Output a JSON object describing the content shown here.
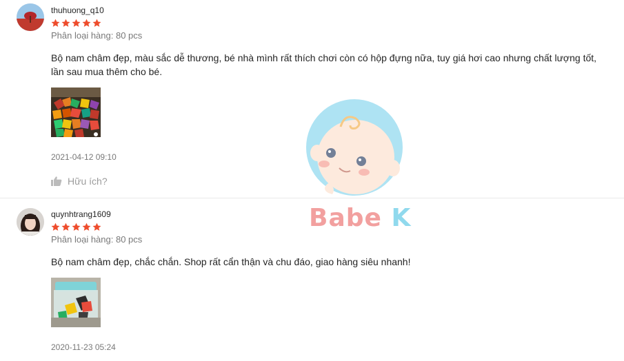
{
  "reviews": [
    {
      "username": "thuhuong_q10",
      "rating": 5,
      "variation": "Phân loại hàng: 80 pcs",
      "comment": "Bộ nam châm đẹp, màu sắc dễ thương, bé nhà mình rất thích chơi còn có hộp đựng nữa, tuy giá hơi cao nhưng chất lượng tốt, lần sau mua thêm cho bé.",
      "timestamp": "2021-04-12 09:10",
      "helpful_label": "Hữu ích?"
    },
    {
      "username": "quynhtrang1609",
      "rating": 5,
      "variation": "Phân loại hàng: 80 pcs",
      "comment": "Bộ nam châm đẹp, chắc chắn. Shop rất cẩn thận và chu đáo, giao hàng siêu nhanh!",
      "timestamp": "2020-11-23 05:24"
    }
  ],
  "watermark": {
    "text_a": "Babe",
    "text_b": "K"
  },
  "colors": {
    "star": "#ee4d2d",
    "watermark_pink": "#f0908f",
    "watermark_blue": "#7dd3ea"
  },
  "icons": {
    "rating": "star-icon",
    "helpful": "thumbs-up-icon"
  }
}
